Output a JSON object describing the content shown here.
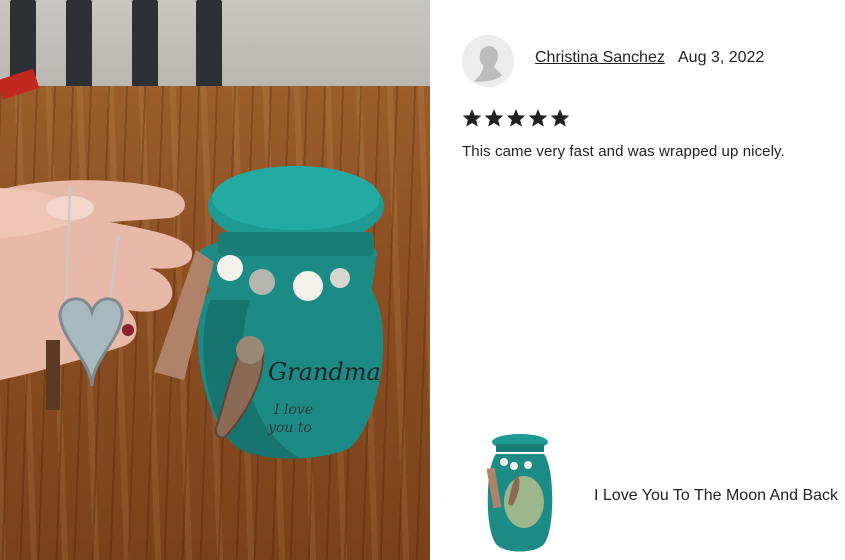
{
  "photo": {
    "alt_icon": "urn-photo",
    "urn_text": "Grandma"
  },
  "review": {
    "reviewer": "Christina Sanchez",
    "date": "Aug 3, 2022",
    "rating": 5,
    "text": "This came very fast and was wrapped up nicely."
  },
  "item": {
    "title": "I Love You To The Moon And Back"
  },
  "colors": {
    "star": "#222222",
    "urn": "#1f8c86",
    "table": "#8d4f22"
  }
}
